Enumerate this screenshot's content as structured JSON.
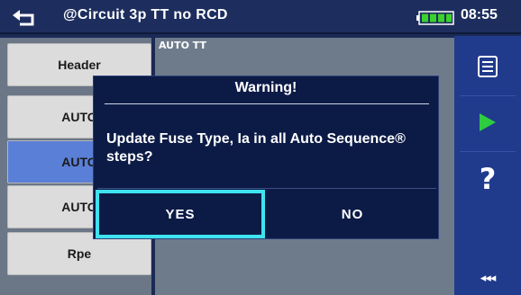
{
  "header": {
    "title": "@Circuit 3p TT no RCD",
    "time": "08:55",
    "back_icon": "return-arrow-icon",
    "battery_icon": "battery-full-icon",
    "battery_color": "#3bd12e"
  },
  "list": {
    "items": [
      {
        "label": "Header",
        "selected": false
      },
      {
        "label": "AUTO",
        "selected": false
      },
      {
        "label": "AUTO",
        "selected": true
      },
      {
        "label": "AUTO",
        "selected": false
      },
      {
        "label": "Rpe",
        "selected": false
      }
    ],
    "selected_color": "#5a7fd6"
  },
  "detail": {
    "label": "AUTO TT"
  },
  "sidebar": {
    "items": [
      {
        "icon": "list-icon"
      },
      {
        "icon": "play-icon",
        "color": "#2ecc40"
      },
      {
        "icon": "help-icon",
        "label": "?"
      },
      {
        "icon": "back-arrows-icon",
        "label": "◂◂◂"
      }
    ]
  },
  "dialog": {
    "title": "Warning!",
    "message": "Update Fuse Type, Ia in all Auto Sequence® steps?",
    "yes_label": "YES",
    "no_label": "NO",
    "focus_color": "#3fe3f0"
  }
}
